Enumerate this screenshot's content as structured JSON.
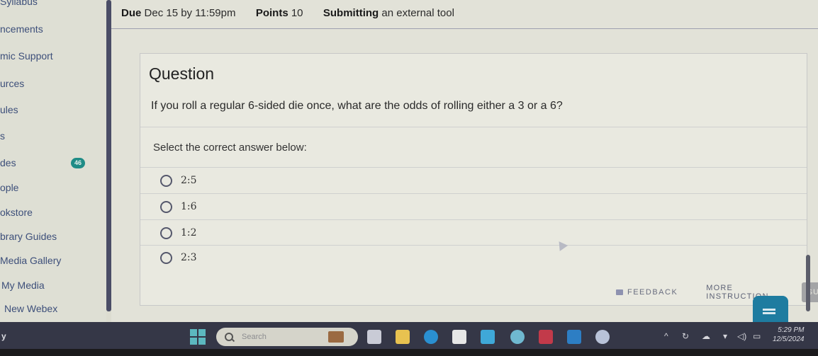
{
  "sidebar": {
    "items": [
      {
        "label": "Syllabus"
      },
      {
        "label": "ncements"
      },
      {
        "label": "mic Support"
      },
      {
        "label": "urces"
      },
      {
        "label": "ules"
      },
      {
        "label": "s"
      },
      {
        "label": "des"
      },
      {
        "label": "ople"
      },
      {
        "label": "okstore"
      },
      {
        "label": "brary Guides"
      },
      {
        "label": "Media Gallery"
      },
      {
        "label": "My Media"
      },
      {
        "label": "New Webex"
      }
    ],
    "grades_badge": "46"
  },
  "assignment_meta": {
    "due_label": "Due",
    "due_value": "Dec 15 by 11:59pm",
    "points_label": "Points",
    "points_value": "10",
    "submitting_label": "Submitting",
    "submitting_value": "an external tool"
  },
  "question": {
    "title": "Question",
    "text": "If you roll a regular 6-sided die once, what are the odds of rolling either a 3 or a 6?",
    "instruction": "Select the correct answer below:",
    "options": [
      {
        "label": "2:5",
        "selected": false
      },
      {
        "label": "1:6",
        "selected": false
      },
      {
        "label": "1:2",
        "selected": false
      },
      {
        "label": "2:3",
        "selected": false
      }
    ]
  },
  "footer": {
    "feedback_label": "FEEDBACK",
    "more_instruction_label": "MORE INSTRUCTION",
    "submit_label": "SUBMIT"
  },
  "taskbar": {
    "left_text": "y",
    "search_placeholder": "Search",
    "time": "5:29 PM",
    "date": "12/5/2024",
    "apps": [
      "task-view",
      "file-explorer",
      "edge",
      "store",
      "app-teal",
      "app-color",
      "mcafee",
      "outlook",
      "settings"
    ],
    "tray_icons": [
      "chevron-up",
      "sync",
      "cloud",
      "wifi",
      "volume",
      "battery"
    ]
  },
  "colors": {
    "badge": "#1f8c86",
    "sidebar_link": "#3d4f7a",
    "taskbar": "#353747",
    "chat_widget": "#1e7ca0"
  }
}
